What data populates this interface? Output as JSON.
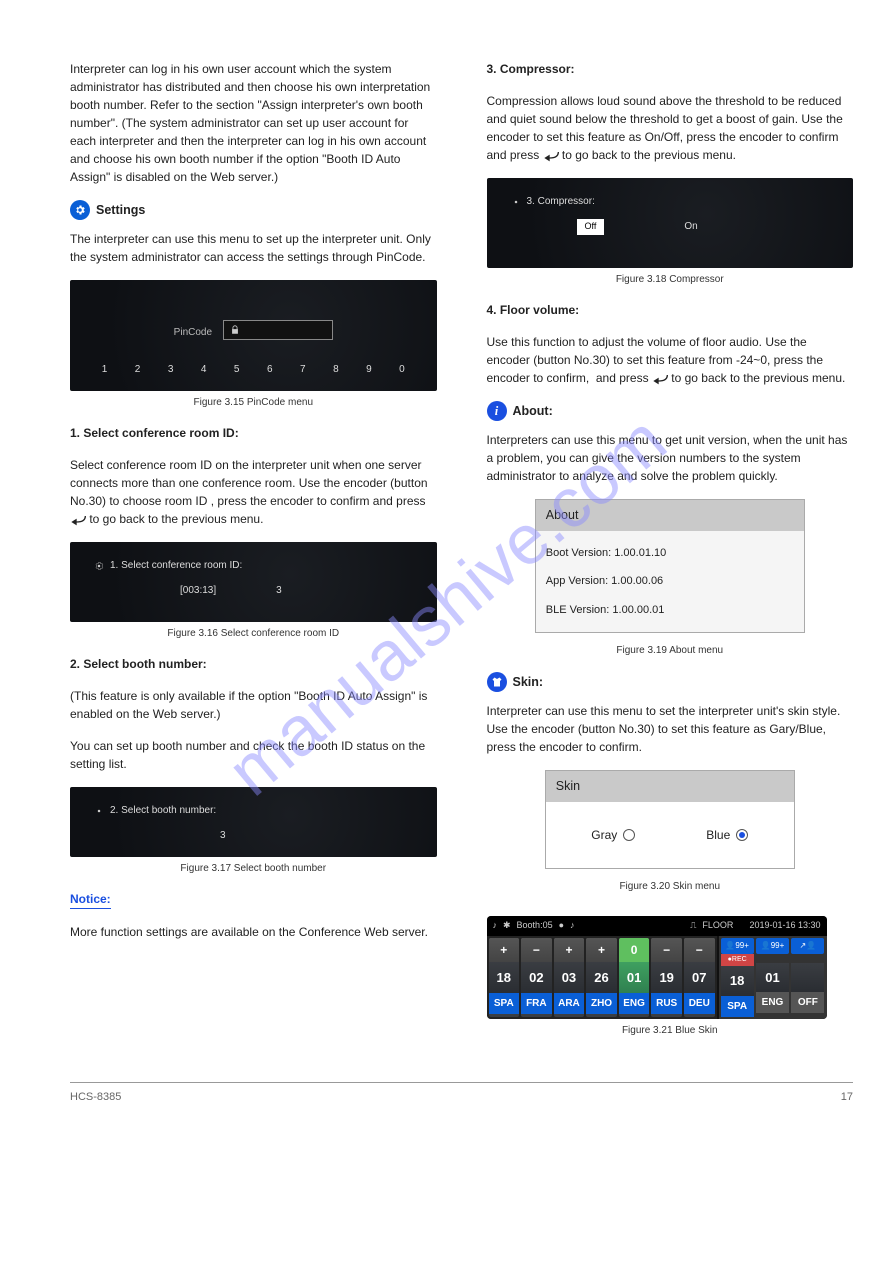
{
  "left": {
    "intro1": "Interpreter can log in his own user account which the system administrator has distributed and then choose his own interpretation booth number. Refer to the section ",
    "intro1_b": "\"Assign interpreter's own booth number\". (The system administrator can set up user account for each interpreter and then the interpreter can log in his own account and choose his own booth number if the option \"Booth ID Auto Assign\" is disabled on the Web server.)",
    "settings_heading": "Settings",
    "settings_para": "The interpreter can use this menu to set up the interpreter unit. Only the system administrator can access the settings through PinCode.",
    "shot1": {
      "label": "PinCode",
      "digits": [
        "1",
        "2",
        "3",
        "4",
        "5",
        "6",
        "7",
        "8",
        "9",
        "0"
      ]
    },
    "fig1": "Figure 3.15 PinCode menu",
    "sec1": {
      "title": "1. Select conference room ID:",
      "text": "Select conference room ID on the interpreter unit when one server connects more than one conference room. Use the encoder (button No.30) to choose room ID , press the encoder to confirm and press       to go back to the previous menu.",
      "shot_label": "1. Select conference room ID:",
      "shot_id": "[003:13]",
      "shot_val": "3"
    },
    "fig2": "Figure 3.16 Select conference room ID",
    "sec2": {
      "title": "2. Select booth number:",
      "text": "(This feature is only available if the option \"Booth ID Auto Assign\" is enabled on the Web server.)",
      "text2": "You can set up booth number and check the booth ID status on the setting list.",
      "shot_label": "2. Select booth number:",
      "shot_val": "3"
    },
    "fig3": "Figure 3.17 Select booth number",
    "note_label": "Notice:",
    "note_text": "More function settings are available on the Conference Web server."
  },
  "right": {
    "sec3": {
      "title": "3. Compressor:",
      "text": "Compression allows loud sound above the threshold to be reduced and quiet sound below the threshold to get a boost of gain. Use the encoder to set this feature as On/Off, press the encoder to confirm and press       to go back to the previous menu.",
      "shot_label": "3. Compressor:",
      "off": "Off",
      "on": "On"
    },
    "fig4": "Figure 3.18 Compressor",
    "sec4": {
      "title": "4. Floor volume:",
      "text": "Use this function to adjust the volume of floor audio. Use the encoder (button No.30) to set this feature from -24~0, press the encoder to confirm,  and press       to go back to the previous menu."
    },
    "about_heading": "About:",
    "about_text": "Interpreters can use this menu to get unit version, when the unit has a problem, you can give the version numbers to the system administrator to analyze and solve the problem quickly.",
    "about_box": {
      "title": "About",
      "boot": "Boot Version: 1.00.01.10",
      "app": "App Version: 1.00.00.06",
      "ble": "BLE Version: 1.00.00.01"
    },
    "fig5": "Figure 3.19 About menu",
    "skin_heading": "Skin:",
    "skin_text": "Interpreter can use this menu to set the interpreter unit's skin style. Use the encoder (button No.30) to set this feature as Gary/Blue, press the encoder to confirm.",
    "skin_box": {
      "title": "Skin",
      "gray": "Gray",
      "blue": "Blue"
    },
    "fig6": "Figure 3.20 Skin menu",
    "panel": {
      "top_booth": "Booth:05",
      "floor": "FLOOR",
      "time": "2019-01-16  13:30",
      "cells": [
        {
          "pm": "+",
          "n": "18",
          "lang": "SPA"
        },
        {
          "pm": "−",
          "n": "02",
          "lang": "FRA"
        },
        {
          "pm": "+",
          "n": "03",
          "lang": "ARA"
        },
        {
          "pm": "+",
          "n": "26",
          "lang": "ZHO"
        },
        {
          "pm": "0",
          "n": "01",
          "lang": "ENG",
          "eng": true
        },
        {
          "pm": "−",
          "n": "19",
          "lang": "RUS"
        },
        {
          "pm": "−",
          "n": "07",
          "lang": "DEU"
        }
      ],
      "right": {
        "p1": "99+",
        "p2": "99+",
        "p3": "",
        "rec": "REC",
        "n1": "18",
        "n2": "01",
        "l1": "SPA",
        "l2": "ENG",
        "l3": "OFF"
      }
    },
    "fig7": "Figure 3.21 Blue Skin"
  },
  "footer": {
    "model": "HCS-8385",
    "page": "17"
  },
  "watermark": "manualshive.com"
}
